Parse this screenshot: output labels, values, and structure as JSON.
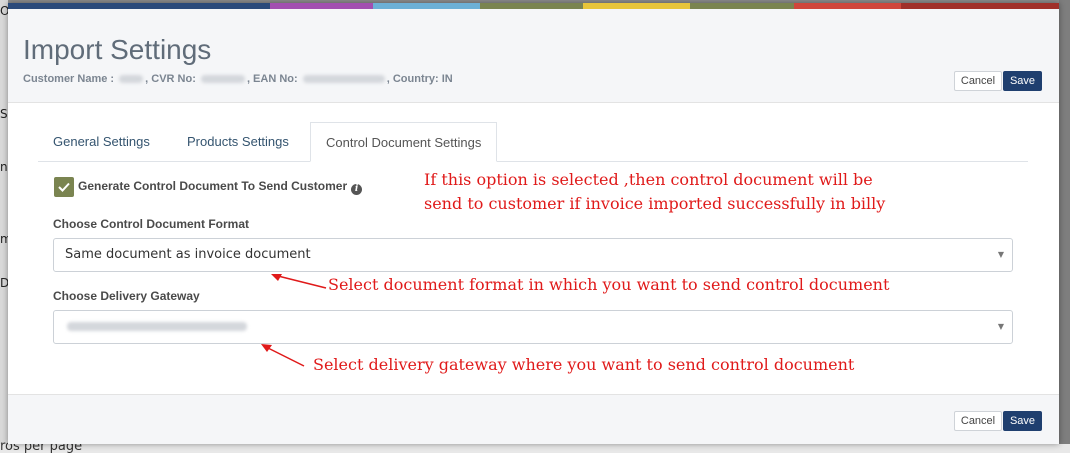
{
  "header": {
    "title": "Import Settings",
    "customer_name_label": "Customer Name :",
    "cvr_label": ", CVR No:",
    "ean_label": ", EAN No:",
    "country_label": ", Country: IN",
    "cancel_label": "Cancel",
    "save_label": "Save"
  },
  "tabs": [
    {
      "label": "General Settings"
    },
    {
      "label": "Products Settings"
    },
    {
      "label": "Control Document Settings",
      "active": true
    }
  ],
  "form": {
    "generate_label": "Generate Control Document To Send Customer",
    "format_label": "Choose Control Document Format",
    "format_value": "Same document as invoice document",
    "gateway_label": "Choose Delivery Gateway"
  },
  "annotations": {
    "option_note_line1": "If this option is selected ,then control document will be",
    "option_note_line2": "send to customer if invoice imported successfully in billy",
    "format_note": "Select document format in which you want to send control document",
    "gateway_note": "Select delivery gateway where you want to send control document"
  },
  "footer": {
    "cancel_label": "Cancel",
    "save_label": "Save"
  },
  "background": {
    "bottom_text": "ros per page",
    "side_letters": [
      "O",
      "S",
      "n",
      "m",
      "D."
    ]
  },
  "colors": {
    "accent_bar": [
      "#2b4a7a",
      "#a24fb0",
      "#6cb0d6",
      "#7a8450",
      "#e8c53a",
      "#7a8450",
      "#d0463c",
      "#a0302a"
    ],
    "primary_button": "#1f3f6f",
    "annotation_red": "#e01a1a",
    "checkbox": "#7a8450"
  }
}
